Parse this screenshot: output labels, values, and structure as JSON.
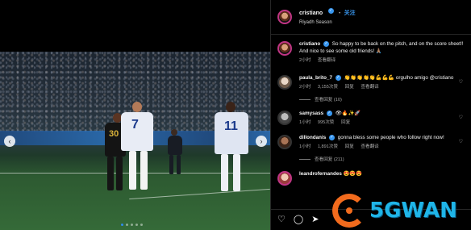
{
  "post": {
    "username": "cristiano",
    "follow_label": "关注",
    "location": "Riyadh Season",
    "caption": "So happy to be back on the pitch, and on the score sheet!! And nice to see some old friends! 🙏🏽",
    "caption_meta": {
      "time": "2小时",
      "translate": "查看翻译"
    }
  },
  "comments": [
    {
      "username": "paula_brito_7",
      "text": "👏👏👏👏👏💪💪💪 orgulho amigo @cristiano",
      "time": "2小时",
      "likes": "3,155次赞",
      "reply": "回复",
      "translate": "查看翻译",
      "replies": "查看回复 (10)"
    },
    {
      "username": "samysass",
      "text": "👁🔥✨🚀",
      "time": "1小时",
      "likes": "995次赞",
      "reply": "回复"
    },
    {
      "username": "dillondanis",
      "text": "gonna bless some people who follow right now!",
      "time": "1小时",
      "likes": "1,891次赞",
      "reply": "回复",
      "translate": "查看翻译",
      "replies": "查看回复 (211)"
    },
    {
      "username": "leandrofernandes",
      "text": "😍😍😍"
    }
  ],
  "actions": {
    "like_icon": "♡",
    "comment_icon": "◯",
    "share_icon": "➤"
  },
  "media": {
    "jersey_left": "30",
    "jersey_mid": "7",
    "jersey_right": "11",
    "prev_icon": "‹",
    "next_icon": "›"
  },
  "watermark": {
    "text": "5GWAN"
  },
  "colors": {
    "accent": "#3897f0",
    "background": "#000000",
    "watermark_orange": "#f26b1d",
    "watermark_blue": "#1fb5e8"
  }
}
